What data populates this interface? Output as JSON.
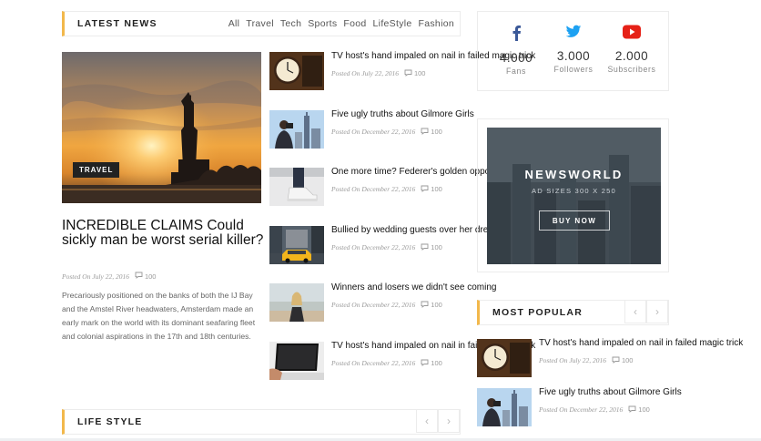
{
  "latest_news": {
    "title": "LATEST NEWS",
    "tabs": [
      "All",
      "Travel",
      "Tech",
      "Sports",
      "Food",
      "LifeStyle",
      "Fashion"
    ]
  },
  "featured": {
    "badge": "TRAVEL",
    "title": "INCREDIBLE CLAIMS Could sickly man be worst serial killer?",
    "date": "Posted On July 22, 2016",
    "comments": "100",
    "excerpt": "Precariously positioned on the banks of both the IJ Bay and the Amstel River headwaters, Amsterdam made an early mark on the world with its dominant seafaring fleet and colonial aspirations in the 17th and 18th centuries."
  },
  "news_list": [
    {
      "title": "TV host's hand impaled on nail in failed magic trick",
      "date": "Posted On July 22, 2016",
      "comments": "100",
      "thumb": "clock"
    },
    {
      "title": "Five ugly truths about Gilmore Girls",
      "date": "Posted On December 22, 2016",
      "comments": "100",
      "thumb": "city-photographer"
    },
    {
      "title": "One more time? Federer's golden opportunity",
      "date": "Posted On December 22, 2016",
      "comments": "100",
      "thumb": "sneakers"
    },
    {
      "title": "Bullied by wedding guests over her dress",
      "date": "Posted On December 22, 2016",
      "comments": "100",
      "thumb": "taxi-street"
    },
    {
      "title": "Winners and losers we didn't see coming",
      "date": "Posted On December 22, 2016",
      "comments": "100",
      "thumb": "beach-girl"
    },
    {
      "title": "TV host's hand impaled on nail in failed magic trick",
      "date": "Posted On December 22, 2016",
      "comments": "100",
      "thumb": "laptop"
    }
  ],
  "life_style": {
    "title": "LIFE STYLE"
  },
  "social": [
    {
      "network": "facebook",
      "icon": "facebook-icon",
      "count": "4.000",
      "label": "Fans",
      "color": "#3b5998"
    },
    {
      "network": "twitter",
      "icon": "twitter-icon",
      "count": "3.000",
      "label": "Followers",
      "color": "#1da1f2"
    },
    {
      "network": "youtube",
      "icon": "youtube-icon",
      "count": "2.000",
      "label": "Subscribers",
      "color": "#e62117"
    }
  ],
  "ad": {
    "title": "NEWSWORLD",
    "subtitle": "AD SIZES 300 X 250",
    "button": "BUY NOW"
  },
  "most_popular": {
    "title": "MOST POPULAR",
    "items": [
      {
        "title": "TV host's hand impaled on nail in failed magic trick",
        "date": "Posted On July 22, 2016",
        "comments": "100",
        "thumb": "clock"
      },
      {
        "title": "Five ugly truths about Gilmore Girls",
        "date": "Posted On December 22, 2016",
        "comments": "100",
        "thumb": "city-photographer"
      }
    ]
  },
  "colors": {
    "accent": "#f2b84b",
    "border": "#ececec"
  }
}
